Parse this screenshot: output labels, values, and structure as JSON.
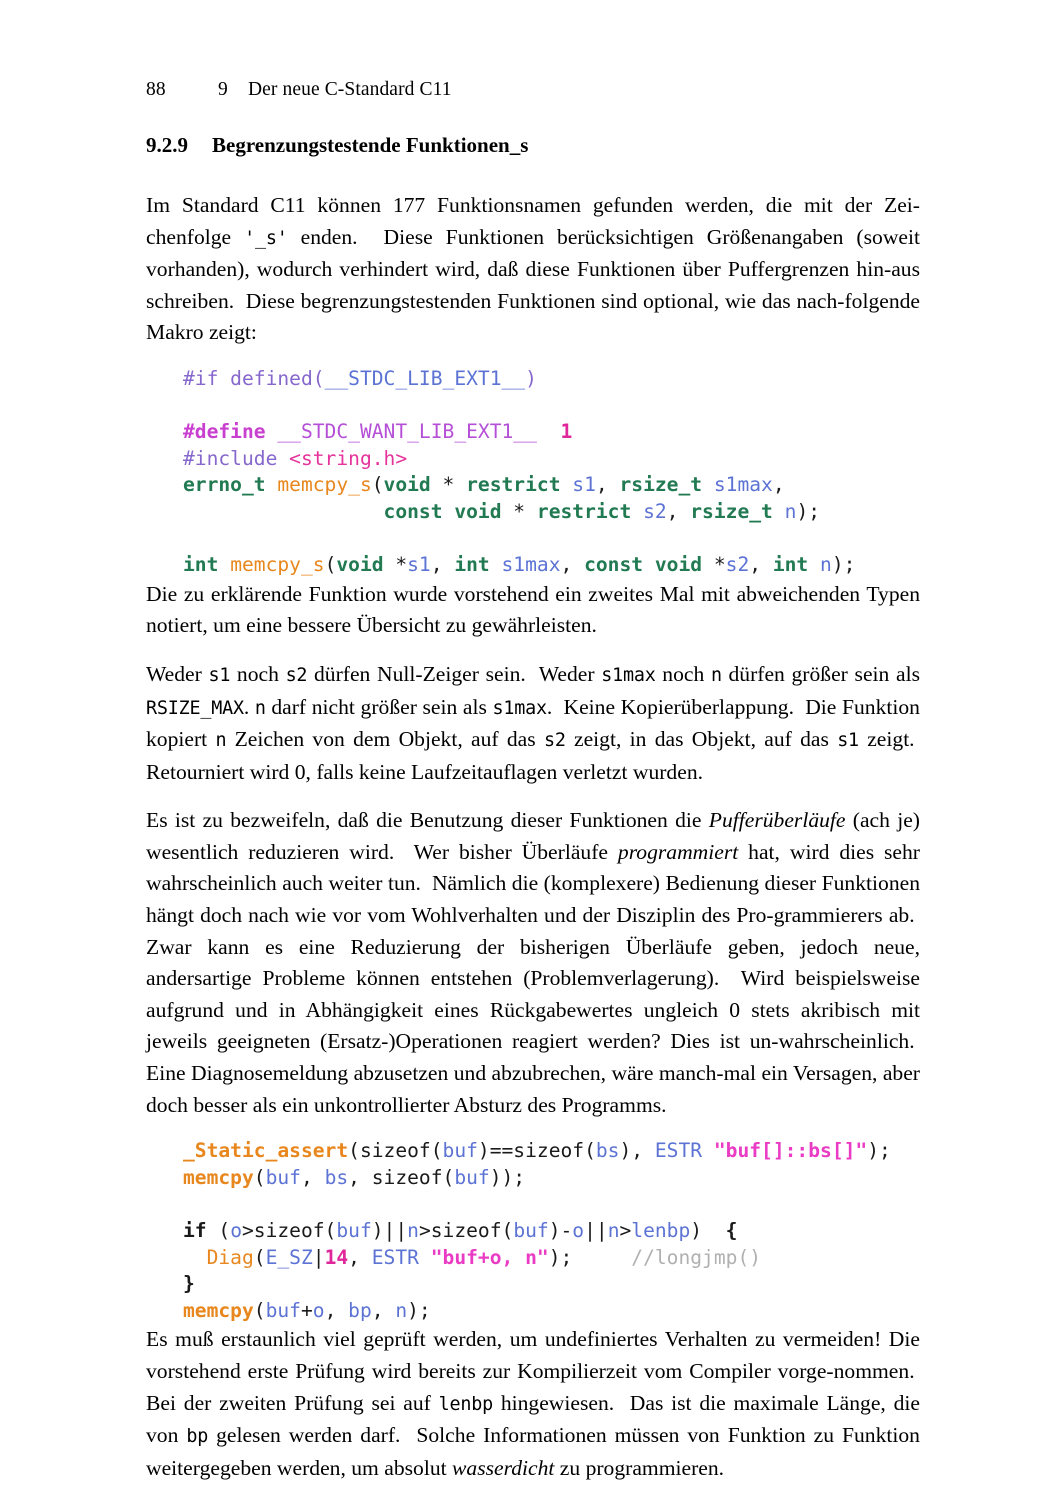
{
  "running_head": {
    "page_number": "88",
    "chapter_number": "9",
    "chapter_title": "Der neue C-Standard C11"
  },
  "section_heading": {
    "number": "9.2.9",
    "title": "Begrenzungstestende Funktionen_s"
  },
  "paragraphs": {
    "p1": "Im Standard C11 können 177 Funktionsnamen gefunden werden, die mit der Zeichenfolge '_s' enden. Diese Funktionen berücksichtigen Größenangaben (soweit vorhanden), wodurch verhindert wird, daß diese Funktionen über Puffergrenzen hinaus schreiben. Diese begrenzungstestenden Funktionen sind optional, wie das nachfolgende Makro zeigt:",
    "p2": "Die zu erklärende Funktion wurde vorstehend ein zweites Mal mit abweichenden Typen notiert, um eine bessere Übersicht zu gewährleisten.",
    "p3": "Weder s1 noch s2 dürfen Null-Zeiger sein. Weder s1max noch n dürfen größer sein als RSIZE_MAX. n darf nicht größer sein als s1max. Keine Kopierüberlappung. Die Funktion kopiert n Zeichen von dem Objekt, auf das s2 zeigt, in das Objekt, auf das s1 zeigt. Retourniert wird 0, falls keine Laufzeitauflagen verletzt wurden.",
    "p4": "Es ist zu bezweifeln, daß die Benutzung dieser Funktionen die Pufferüberläufe (ach je) wesentlich reduzieren wird. Wer bisher Überläufe programmiert hat, wird dies sehr wahrscheinlich auch weiter tun. Nämlich die (komplexere) Bedienung dieser Funktionen hängt doch nach wie vor vom Wohlverhalten und der Disziplin des Programmierers ab. Zwar kann es eine Reduzierung der bisherigen Überläufe geben, jedoch neue, andersartige Probleme können entstehen (Problemverlagerung). Wird beispielsweise aufgrund und in Abhängigkeit eines Rückgabewertes ungleich 0 stets akribisch mit jeweils geeigneten (Ersatz-)Operationen reagiert werden? Dies ist unwahrscheinlich. Eine Diagnosemeldung abzusetzen und abzubrechen, wäre manchmal ein Versagen, aber doch besser als ein unkontrollierter Absturz des Programms.",
    "p5": "Es muß erstaunlich viel geprüft werden, um undefiniertes Verhalten zu vermeiden! Die vorstehend erste Prüfung wird bereits zur Kompilierzeit vom Compiler vorgenommen. Bei der zweiten Prüfung sei auf lenbp hingewiesen. Das ist die maximale Länge, die von bp gelesen werden darf. Solche Informationen müssen von Funktion zu Funktion weitergegeben werden, um absolut wasserdicht zu programmieren."
  },
  "inline_code": {
    "suffix_s": "'_s'",
    "s1": "s1",
    "s2": "s2",
    "s1max": "s1max",
    "n": "n",
    "rsize_max": "RSIZE_MAX",
    "lenbp": "lenbp",
    "bp": "bp"
  },
  "code_block_1": {
    "lines": [
      "#if defined(__STDC_LIB_EXT1__)",
      "",
      "#define __STDC_WANT_LIB_EXT1__  1",
      "#include <string.h>",
      "errno_t memcpy_s(void * restrict s1, rsize_t s1max,",
      "                 const void * restrict s2, rsize_t n);",
      "",
      "int memcpy_s(void *s1, int s1max, const void *s2, int n);"
    ],
    "line1": {
      "pp": "#if defined(",
      "ident": "__STDC_LIB_EXT1__",
      "close": ")"
    },
    "line3": {
      "pp": "#define ",
      "macro": "__STDC_WANT_LIB_EXT1__",
      "gap": "  ",
      "num": "1"
    },
    "line4": {
      "pp": "#include ",
      "header": "<string.h>"
    },
    "line5": {
      "t_errno": "errno_t",
      "fn": "memcpy_s",
      "open": "(",
      "t_void": "void",
      "star": " * ",
      "t_restrict": "restrict",
      "id_s1": "s1",
      "comma1": ", ",
      "t_rsize": "rsize_t",
      "id_s1max": "s1max",
      "comma2": ","
    },
    "line6": {
      "indent": "                 ",
      "t_const": "const",
      "t_void": "void",
      "star": " * ",
      "t_restrict": "restrict",
      "id_s2": "s2",
      "comma": ", ",
      "t_rsize": "rsize_t",
      "id_n": "n",
      "close": ");"
    },
    "line8": {
      "t_int": "int",
      "fn": "memcpy_s",
      "open": "(",
      "t_void": "void",
      "star": " *",
      "id_s1": "s1",
      "c1": ", ",
      "t_int2": "int",
      "id_s1max": "s1max",
      "c2": ", ",
      "t_const": "const",
      "t_void2": "void",
      "star2": " *",
      "id_s2": "s2",
      "c3": ", ",
      "t_int3": "int",
      "id_n": "n",
      "close": ");"
    }
  },
  "code_block_2": {
    "lines": [
      "_Static_assert(sizeof(buf)==sizeof(bs), ESTR \"buf[]::bs[]\");",
      "memcpy(buf, bs, sizeof(buf));",
      "",
      "if (o>sizeof(buf)||n>sizeof(buf)-o||n>lenbp)  {",
      "  Diag(E_SZ|14, ESTR \"buf+o, n\");     //longjmp()",
      "}",
      "memcpy(buf+o, bp, n);"
    ],
    "line1": {
      "fn": "_Static_assert",
      "p1": "(sizeof(",
      "id_buf": "buf",
      "p2": ")==sizeof(",
      "id_bs": "bs",
      "p3": "), ",
      "id_estr": "ESTR",
      "sp": " ",
      "str": "\"buf[]::bs[]\"",
      "p4": ");"
    },
    "line2": {
      "fn": "memcpy",
      "p1": "(",
      "id_buf": "buf",
      "p2": ", ",
      "id_bs": "bs",
      "p3": ", sizeof(",
      "id_buf2": "buf",
      "p4": "));"
    },
    "line4": {
      "kw_if": "if",
      "p1": " (",
      "id_o": "o",
      "p2": ">sizeof(",
      "id_buf": "buf",
      "p3": ")||",
      "id_n": "n",
      "p4": ">sizeof(",
      "id_buf2": "buf",
      "p5": ")-",
      "id_o2": "o",
      "p6": "||",
      "id_n2": "n",
      "p7": ">",
      "id_lenbp": "lenbp",
      "p8": ")  ",
      "brace": "{"
    },
    "line5": {
      "indent": "  ",
      "fn": "Diag",
      "p1": "(",
      "id_esz": "E_SZ",
      "p2": "|",
      "num": "14",
      "p3": ", ",
      "id_estr": "ESTR",
      "sp": " ",
      "str": "\"buf+o, n\"",
      "p4": ");",
      "gap": "     ",
      "comment": "//longjmp()"
    },
    "line6": {
      "brace": "}"
    },
    "line7": {
      "fn": "memcpy",
      "p1": "(",
      "id_buf": "buf",
      "p2": "+",
      "id_o": "o",
      "p3": ", ",
      "id_bp": "bp",
      "p4": ", ",
      "id_n": "n",
      "p5": ");"
    }
  },
  "colors": {
    "preprocessor_violet": "#8667cc",
    "define_magenta": "#c93fd0",
    "identifier_blue": "#5c73d4",
    "type_green": "#217a52",
    "function_orange": "#e8871e",
    "string_magenta": "#ea3bc4",
    "number_magenta": "#e0269b",
    "comment_grey": "#b0b0b0",
    "text_black": "#000000"
  }
}
